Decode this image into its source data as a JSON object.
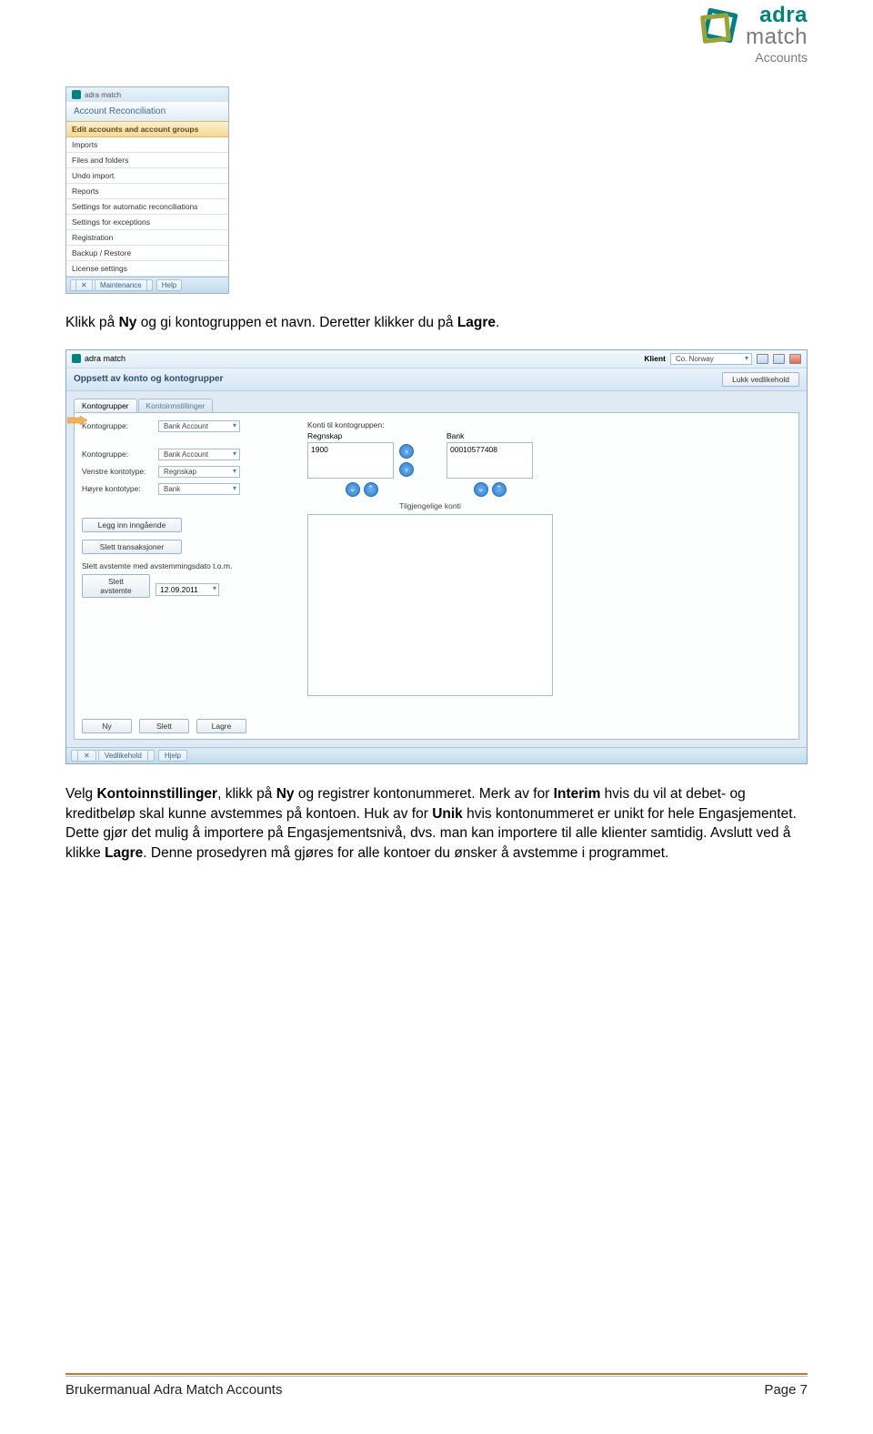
{
  "logo": {
    "line1": "adra",
    "line2": "match",
    "sub": "Accounts"
  },
  "shot1": {
    "app_name": "adra match",
    "title": "Account Reconciliation",
    "panel_header": "Edit accounts and account groups",
    "menu_items": [
      "Imports",
      "Files and folders",
      "Undo import",
      "Reports",
      "Settings for automatic reconciliations",
      "Settings for exceptions",
      "Registration",
      "Backup / Restore",
      "License settings"
    ],
    "bottombar": [
      "Maintenance",
      "Help"
    ],
    "bottom_prefix": "✕"
  },
  "para1": {
    "pre": "Klikk på ",
    "b1": "Ny",
    "mid1": " og gi kontogruppen et navn. Deretter klikker du på ",
    "b2": "Lagre",
    "post": "."
  },
  "shot2": {
    "app_name": "adra match",
    "klient_label": "Klient",
    "klient_value": "Co. Norway",
    "subheader": "Oppsett av konto og kontogrupper",
    "close_btn": "Lukk vedlikehold",
    "tabs": [
      "Kontogrupper",
      "Kontoinnstillinger"
    ],
    "fields": {
      "kontogruppe_label": "Kontogruppe:",
      "kontogruppe_value": "Bank Account",
      "kontogruppe2_label": "Kontogruppe:",
      "kontogruppe2_value": "Bank Account",
      "venstre_label": "Venstre kontotype:",
      "venstre_value": "Regnskap",
      "hoyre_label": "Høyre kontotype:",
      "hoyre_value": "Bank"
    },
    "konto_header": "Konti til kontogruppen:",
    "kcol1_label": "Regnskap",
    "kcol1_value": "1900",
    "kcol2_label": "Bank",
    "kcol2_value": "00010577408",
    "tilgjengelige": "Tilgjengelige konti",
    "legg_btn": "Legg inn inngående",
    "slett_trans_btn": "Slett transaksjoner",
    "slett_line": "Slett avstemte med avstemmingsdato t.o.m.",
    "slett_avstemte_btn": "Slett avstemte",
    "date_value": "12.09.2011",
    "bottom_btns": [
      "Ny",
      "Slett",
      "Lagre"
    ],
    "statusbar": [
      "Vedlikehold",
      "Hjelp"
    ],
    "status_prefix": "✕"
  },
  "para2": {
    "t1": "Velg ",
    "b1": "Kontoinnstillinger",
    "t2": ", klikk på ",
    "b2": "Ny",
    "t3": " og registrer kontonummeret. Merk av for ",
    "b3": "Interim",
    "t4": " hvis du vil at debet- og kreditbeløp skal kunne avstemmes på kontoen. Huk av for ",
    "b4": "Unik",
    "t5": " hvis kontonummeret er unikt for hele Engasjementet. Dette gjør det mulig å importere på Engasjementsnivå, dvs. man kan importere til alle klienter samtidig. Avslutt ved å klikke ",
    "b5": "Lagre",
    "t6": ". Denne prosedyren må gjøres for alle kontoer du ønsker å avstemme i programmet."
  },
  "footer": {
    "left": "Brukermanual Adra Match Accounts",
    "right": "Page 7"
  }
}
